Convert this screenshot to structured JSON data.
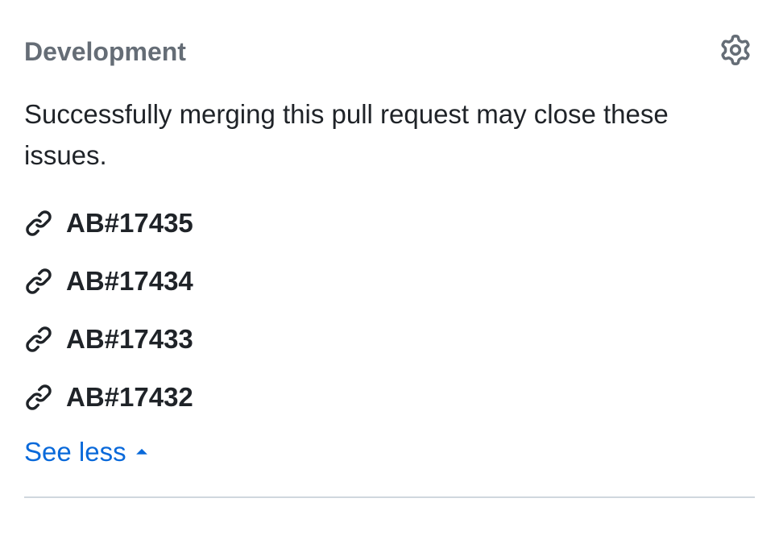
{
  "section": {
    "title": "Development",
    "description": "Successfully merging this pull request may close these issues."
  },
  "links": [
    {
      "label": "AB#17435"
    },
    {
      "label": "AB#17434"
    },
    {
      "label": "AB#17433"
    },
    {
      "label": "AB#17432"
    }
  ],
  "toggle": {
    "label": "See less"
  }
}
